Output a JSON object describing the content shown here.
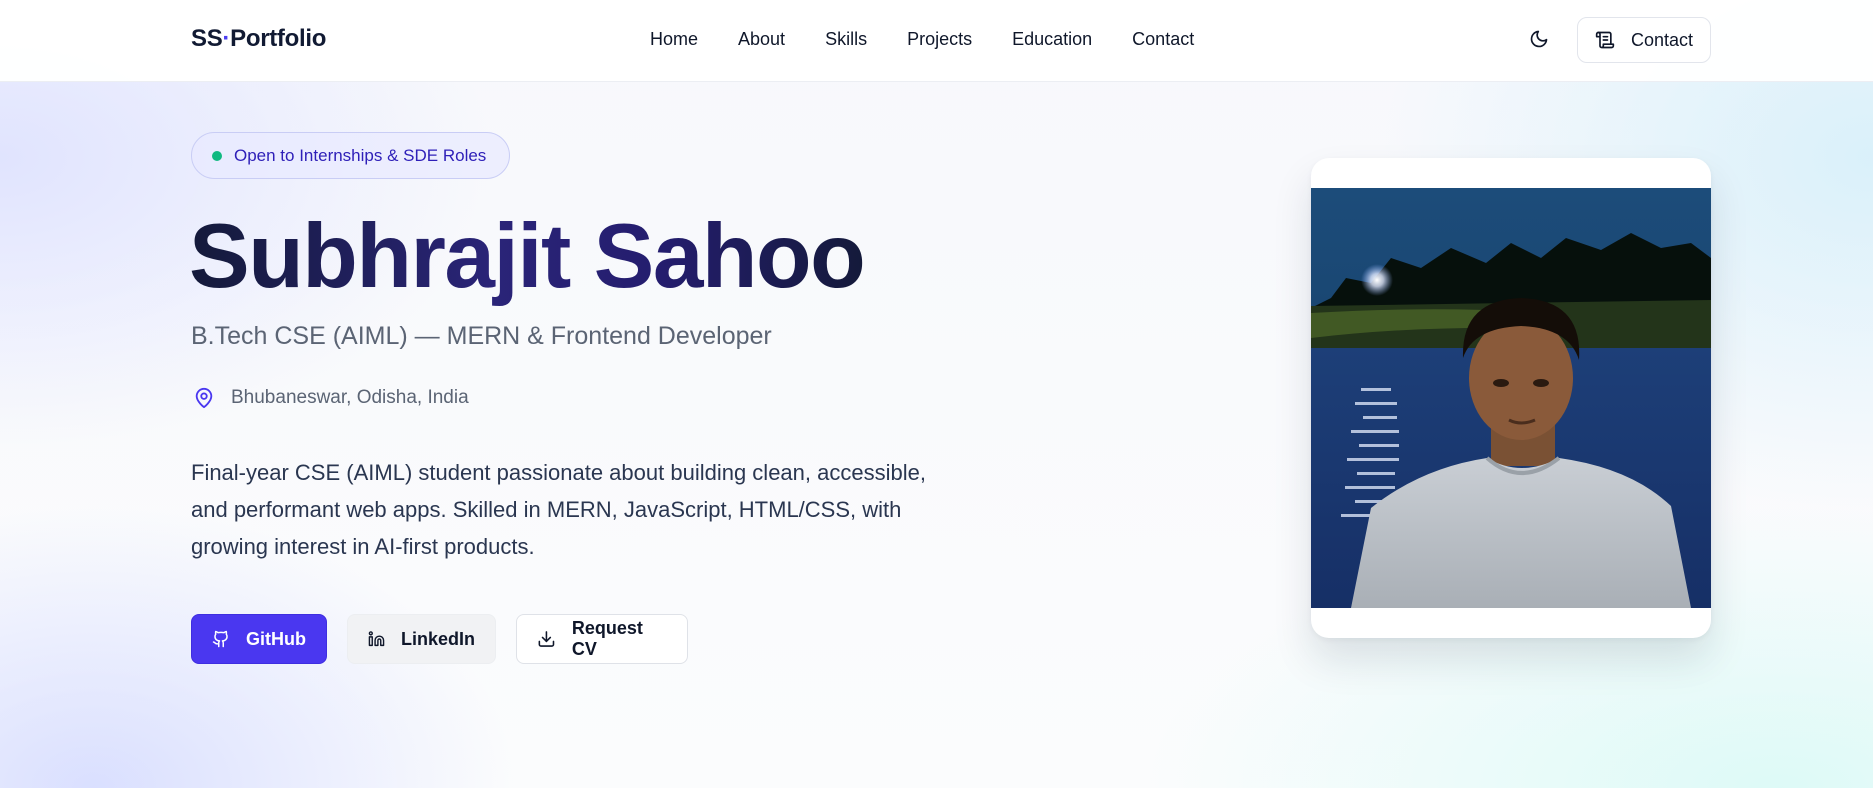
{
  "header": {
    "logo_part1": "SS",
    "logo_dot": "·",
    "logo_part2": "Portfolio",
    "nav": [
      "Home",
      "About",
      "Skills",
      "Projects",
      "Education",
      "Contact"
    ],
    "contact_label": "Contact",
    "theme_icon": "moon-icon",
    "contact_icon": "scroll-icon"
  },
  "hero": {
    "badge": "Open to Internships & SDE Roles",
    "badge_dot_color": "#10b981",
    "name": "Subhrajit Sahoo",
    "subtitle": "B.Tech CSE (AIML) — MERN & Frontend Developer",
    "location": "Bhubaneswar, Odisha, India",
    "location_icon": "map-pin-icon",
    "bio": "Final-year CSE (AIML) student passionate about building clean, accessible, and performant web apps. Skilled in MERN, JavaScript, HTML/CSS, with growing interest in AI-first products.",
    "buttons": {
      "github": "GitHub",
      "linkedin": "LinkedIn",
      "cv": "Request CV"
    }
  },
  "colors": {
    "accent": "#4a37f0",
    "badge_text": "#2e1fb8",
    "heading": "#141a3a"
  }
}
